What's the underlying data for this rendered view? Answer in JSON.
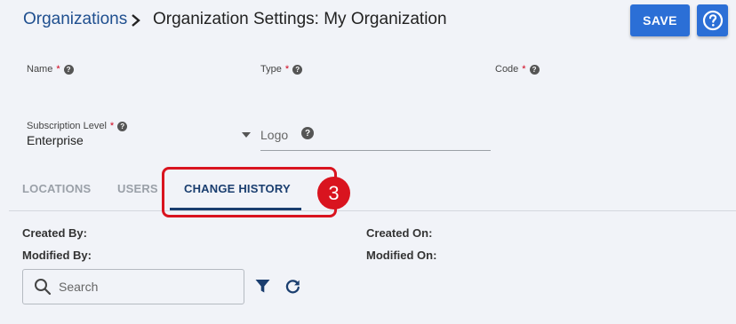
{
  "header": {
    "breadcrumb_root": "Organizations",
    "page_title": "Organization Settings: My Organization",
    "save_label": "SAVE"
  },
  "fields": {
    "name_label": "Name",
    "type_label": "Type",
    "code_label": "Code",
    "required_marker": "*",
    "subscription_label": "Subscription Level",
    "subscription_value": "Enterprise",
    "logo_label": "Logo"
  },
  "tabs": [
    {
      "label": "LOCATIONS",
      "active": false
    },
    {
      "label": "USERS",
      "active": false
    },
    {
      "label": "CHANGE HISTORY",
      "active": true
    }
  ],
  "annotation": {
    "step_number": "3",
    "color": "#d9141f"
  },
  "meta": {
    "created_by_label": "Created By:",
    "created_on_label": "Created On:",
    "modified_by_label": "Modified By:",
    "modified_on_label": "Modified On:"
  },
  "search": {
    "placeholder": "Search"
  },
  "icons": {
    "breadcrumb_separator": "chevron-right-icon",
    "help": "help-circle-icon",
    "field_help": "question-circle-icon",
    "dropdown": "caret-down-icon",
    "search": "search-icon",
    "filter": "filter-icon",
    "refresh": "refresh-icon"
  },
  "colors": {
    "primary_button": "#2b6fd6",
    "breadcrumb_link": "#1f4f8f",
    "active_tab": "#1a3e6f",
    "inactive_tab": "#9aa0a8",
    "required": "#d0021b",
    "background": "#f1f3f8"
  }
}
